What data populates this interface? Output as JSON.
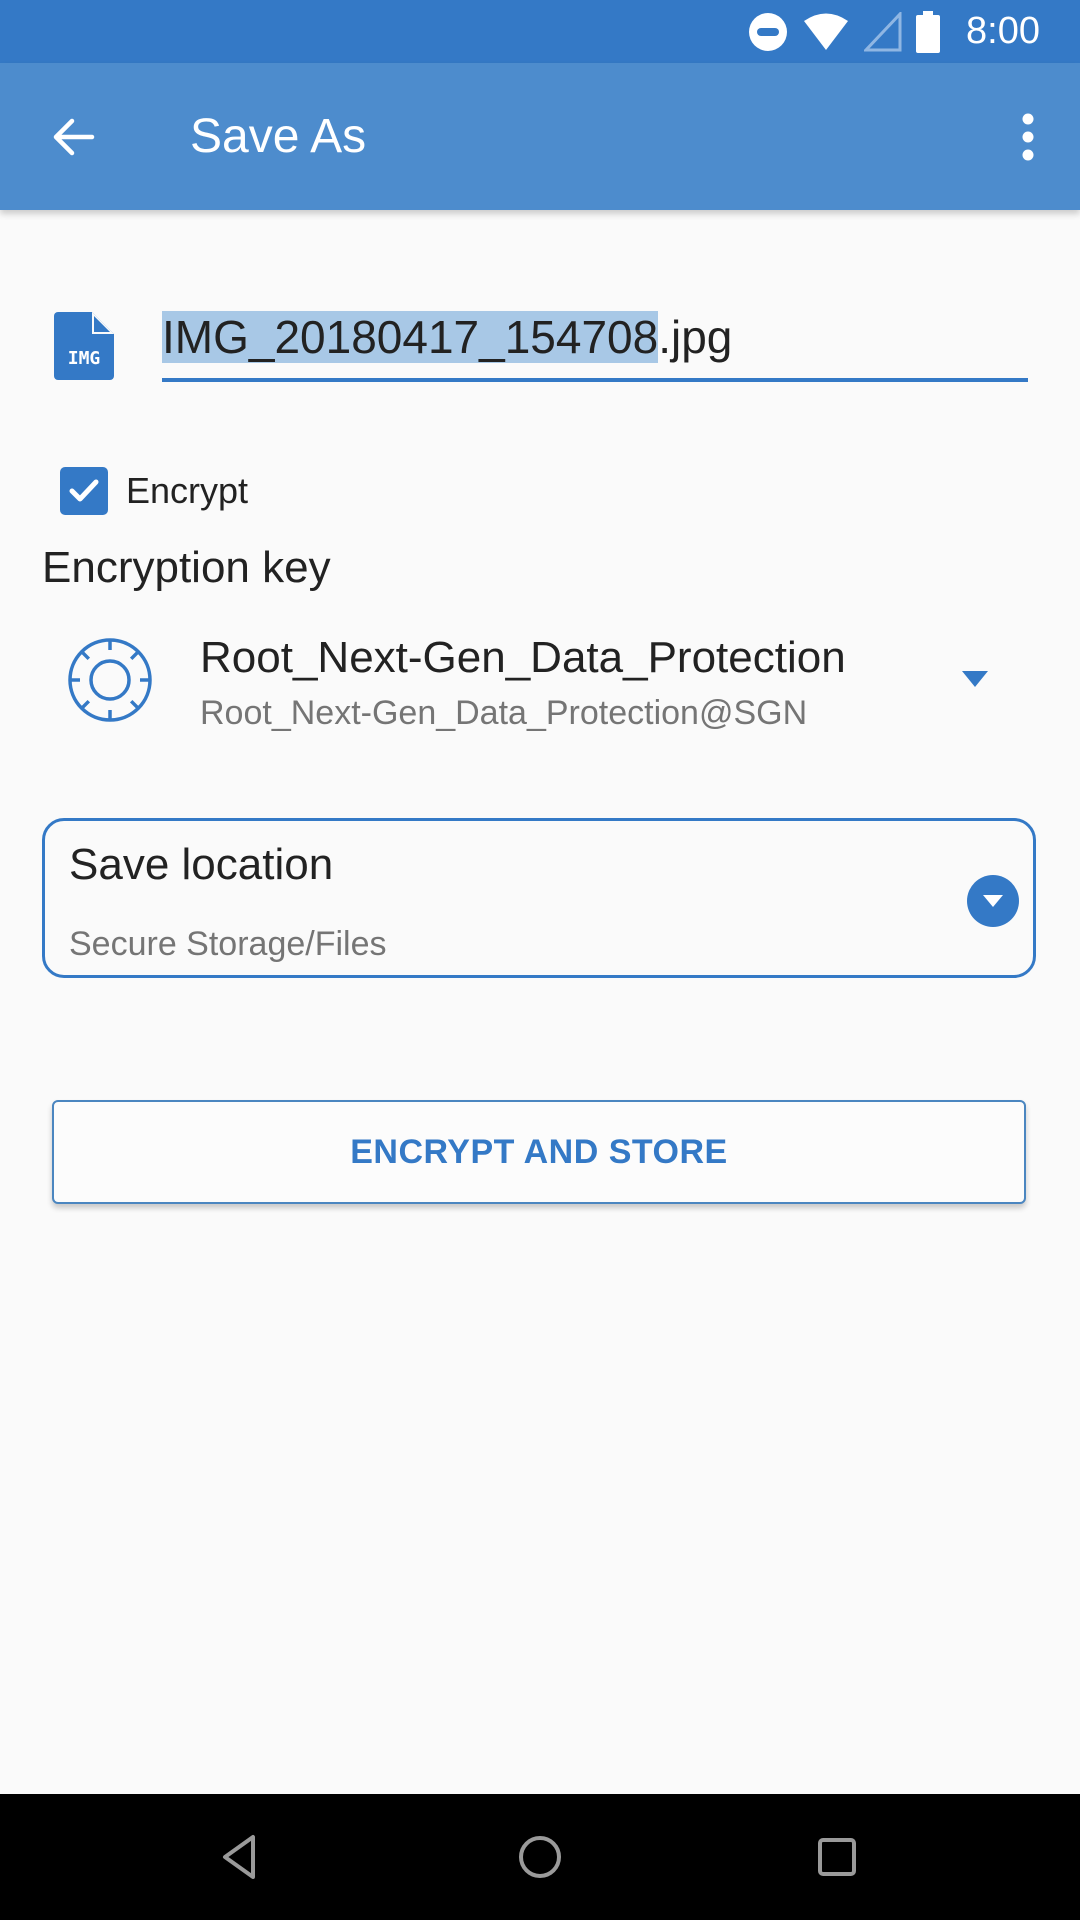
{
  "status_bar": {
    "time": "8:00",
    "icons": [
      "do-not-disturb-icon",
      "wifi-icon",
      "cellular-signal-icon",
      "battery-icon"
    ]
  },
  "app_bar": {
    "title": "Save As",
    "back_icon": "arrow-left-icon",
    "menu_icon": "more-vertical-icon"
  },
  "file": {
    "icon_label": "IMG",
    "name_selected": "IMG_20180417_154708",
    "name_extension": ".jpg"
  },
  "encrypt": {
    "label": "Encrypt",
    "checked": true
  },
  "encryption_key": {
    "heading": "Encryption key",
    "name": "Root_Next-Gen_Data_Protection",
    "id": "Root_Next-Gen_Data_Protection@SGN"
  },
  "save_location": {
    "label": "Save location",
    "value": "Secure Storage/Files"
  },
  "action": {
    "label": "ENCRYPT AND STORE"
  },
  "colors": {
    "status_bar": "#3479c6",
    "app_bar": "#4d8ccd",
    "accent": "#3479c6",
    "selection": "#a8c8e6"
  }
}
